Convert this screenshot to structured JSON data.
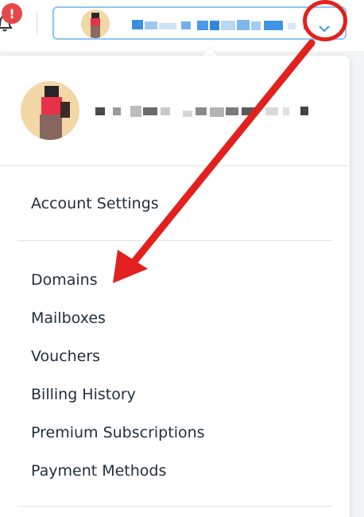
{
  "topbar": {
    "notification_badge": "!",
    "account_email_redacted": true
  },
  "menu": {
    "items": [
      {
        "label": "Account Settings"
      },
      {
        "label": "Domains"
      },
      {
        "label": "Mailboxes"
      },
      {
        "label": "Vouchers"
      },
      {
        "label": "Billing History"
      },
      {
        "label": "Premium Subscriptions"
      },
      {
        "label": "Payment Methods"
      }
    ]
  },
  "colors": {
    "accent_blue": "#3b99e8",
    "highlight_red": "#e2211f",
    "alert_red": "#e8474a",
    "menu_text": "#20303c"
  },
  "icons": [
    "bell-icon",
    "chevron-down-icon"
  ]
}
